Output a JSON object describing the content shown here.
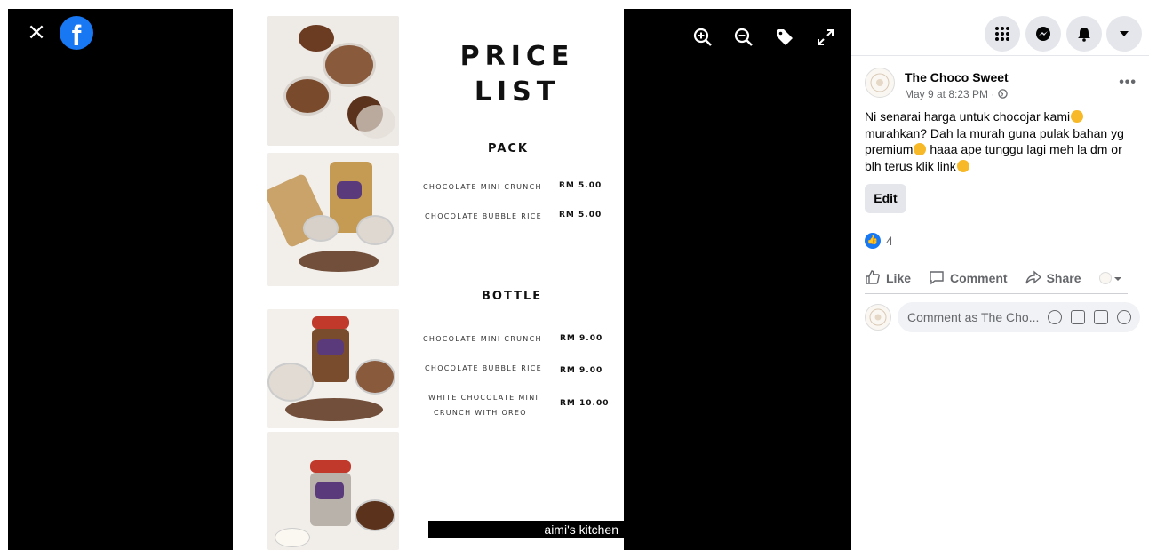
{
  "viewer": {
    "logo_letter": "f",
    "close_glyph": "×",
    "tools": [
      "zoom-in-icon",
      "zoom-out-icon",
      "tag-icon",
      "fullscreen-icon"
    ]
  },
  "flyer": {
    "title_line1": "PRICE",
    "title_line2": "LIST",
    "pack": {
      "heading": "PACK",
      "items": [
        {
          "name": "CHOCOLATE MINI CRUNCH",
          "price": "RM 5.00"
        },
        {
          "name": "CHOCOLATE BUBBLE RICE",
          "price": "RM 5.00"
        }
      ]
    },
    "bottle": {
      "heading": "BOTTLE",
      "items": [
        {
          "name": "CHOCOLATE MINI CRUNCH",
          "price": "RM 9.00"
        },
        {
          "name": "CHOCOLATE BUBBLE RICE",
          "price": "RM 9.00"
        },
        {
          "name_line1": "WHITE CHOCOLATE MINI",
          "name_line2": "CRUNCH WITH OREO",
          "price": "RM 10.00"
        }
      ]
    },
    "brand": "aimi's kitchen"
  },
  "post": {
    "page_name": "The Choco Sweet",
    "meta": "May 9 at 8:23 PM ·",
    "text_parts": [
      "Ni senarai harga untuk chocojar kami",
      " murahkan? Dah la murah guna pulak bahan yg premium",
      " haaa ape tunggu lagi meh la dm or blh terus klik link"
    ],
    "edit_label": "Edit",
    "reaction_count": "4",
    "actions": {
      "like": "Like",
      "comment": "Comment",
      "share": "Share"
    },
    "comment_placeholder": "Comment as The Cho..."
  },
  "colors": {
    "facebook_blue": "#1877f2",
    "button_gray": "#e4e6eb",
    "secondary_text": "#65676b"
  }
}
